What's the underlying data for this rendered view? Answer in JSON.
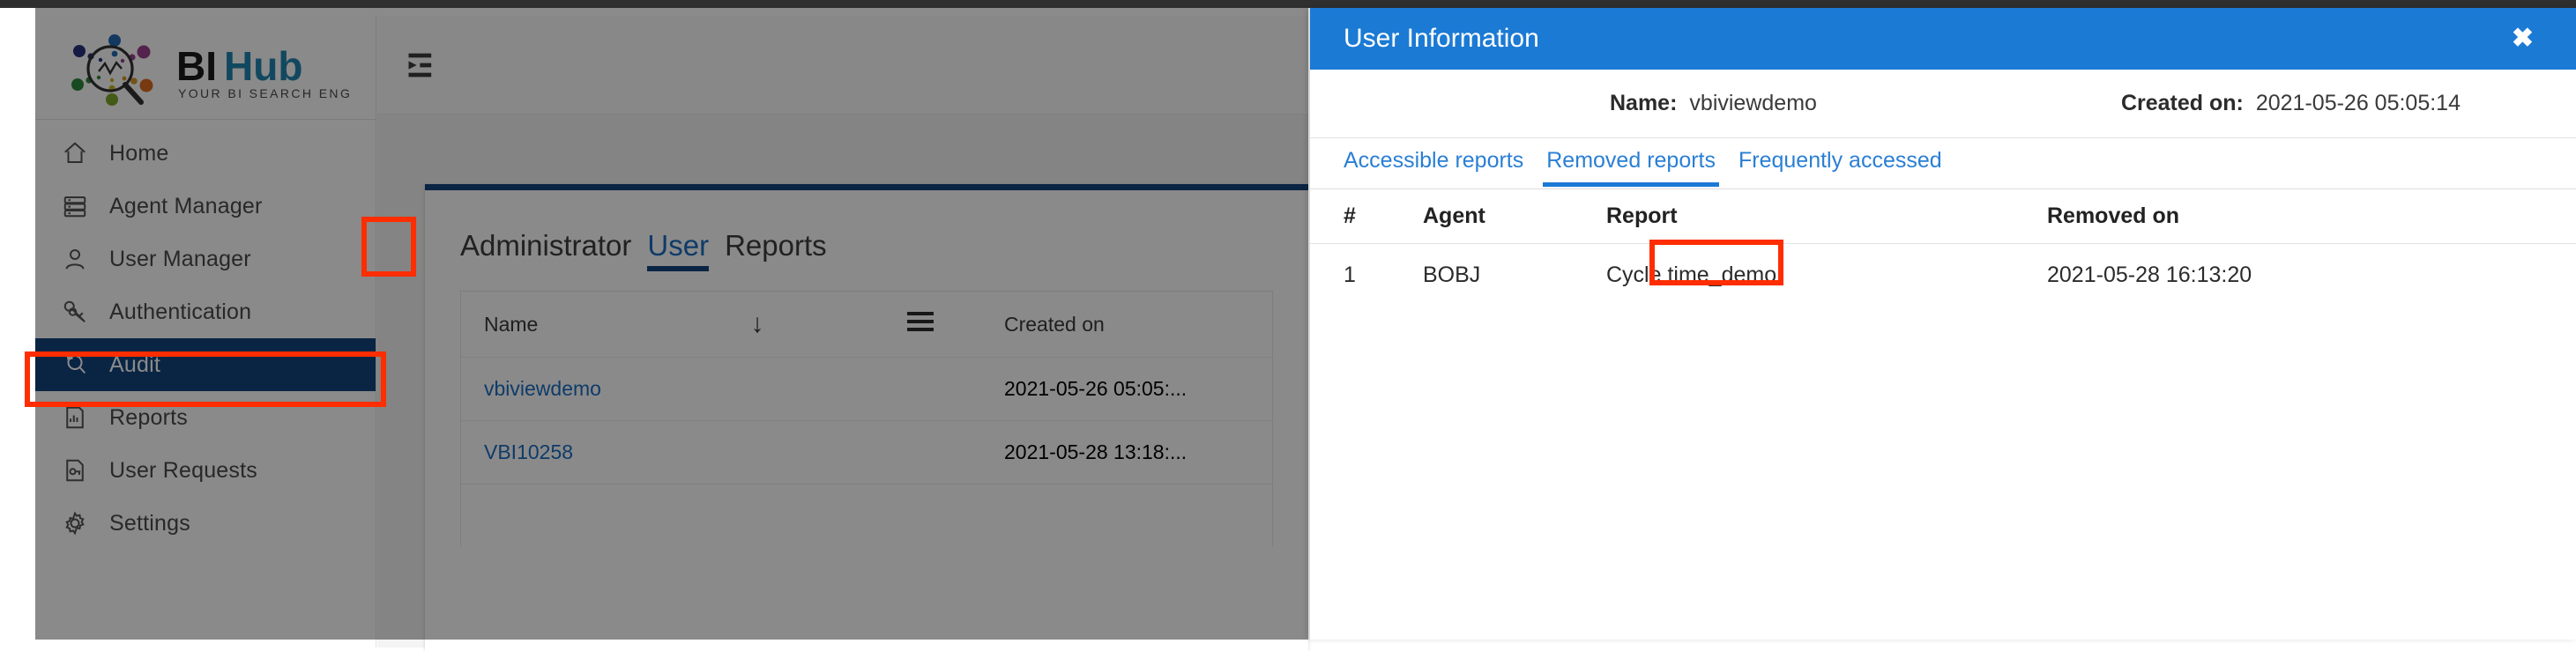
{
  "brand": {
    "name_dark": "BI",
    "name_accent": "Hub",
    "tagline": "YOUR BI SEARCH ENGINE",
    "accent_color": "#2086b0",
    "dark_color": "#1a1a1a"
  },
  "sidebar": {
    "items": [
      {
        "label": "Home",
        "icon": "home-icon",
        "active": false
      },
      {
        "label": "Agent Manager",
        "icon": "server-list-icon",
        "active": false
      },
      {
        "label": "User Manager",
        "icon": "user-icon",
        "active": false
      },
      {
        "label": "Authentication",
        "icon": "keys-icon",
        "active": false
      },
      {
        "label": "Audit",
        "icon": "audit-search-icon",
        "active": true
      },
      {
        "label": "Reports",
        "icon": "report-chart-icon",
        "active": false
      },
      {
        "label": "User Requests",
        "icon": "document-key-icon",
        "active": false
      },
      {
        "label": "Settings",
        "icon": "gear-icon",
        "active": false
      }
    ],
    "active_bg": "#14457e"
  },
  "topbar": {
    "collapse_icon": "menu-collapse-icon"
  },
  "main": {
    "tabs": [
      {
        "label": "Administrator",
        "selected": false
      },
      {
        "label": "User",
        "selected": true
      },
      {
        "label": "Reports",
        "selected": false
      }
    ],
    "table": {
      "headers": {
        "name": "Name",
        "sort": "↓",
        "filter": "filter-icon",
        "created": "Created on"
      },
      "rows": [
        {
          "name": "vbiviewdemo",
          "created": "2021-05-26 05:05:..."
        },
        {
          "name": "VBI10258",
          "created": "2021-05-28 13:18:..."
        }
      ]
    }
  },
  "modal": {
    "title": "User Information",
    "close_label": "✖",
    "header_color": "#1b7ad4",
    "meta": {
      "name_label": "Name:",
      "name_value": "vbiviewdemo",
      "created_label": "Created on:",
      "created_value": "2021-05-26 05:05:14"
    },
    "tabs": [
      {
        "label": "Accessible reports",
        "selected": false
      },
      {
        "label": "Removed reports",
        "selected": true
      },
      {
        "label": "Frequently accessed",
        "selected": false
      }
    ],
    "table": {
      "headers": [
        "#",
        "Agent",
        "Report",
        "Removed on"
      ],
      "rows": [
        {
          "idx": "1",
          "agent": "BOBJ",
          "report": "Cycle time_demo",
          "removed_on": "2021-05-28 16:13:20"
        }
      ]
    }
  },
  "annotations": {
    "highlight_color": "#ff2d00",
    "boxes": [
      "audit-sidebar-item",
      "user-tab",
      "removed-reports-tab"
    ]
  }
}
